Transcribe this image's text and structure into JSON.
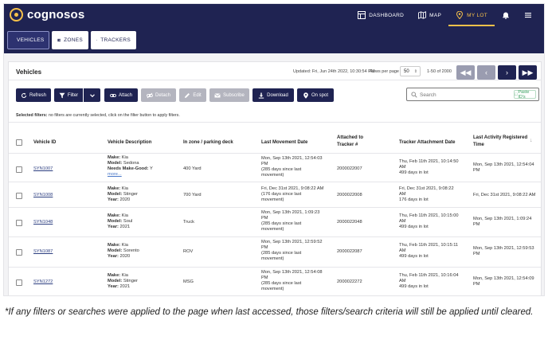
{
  "app": {
    "brand": "cognosos"
  },
  "topnav": [
    {
      "label": "DASHBOARD",
      "icon": "dashboard-icon"
    },
    {
      "label": "MAP",
      "icon": "map-icon"
    },
    {
      "label": "MY LOT",
      "icon": "location-pin-icon"
    }
  ],
  "topnav_icons": [
    "bell-icon",
    "hamburger-menu-icon"
  ],
  "subtabs": [
    {
      "label": "VEHICLES",
      "icon": "car-icon"
    },
    {
      "label": "ZONES",
      "icon": "grid-icon"
    },
    {
      "label": "TRACKERS",
      "icon": "target-icon"
    }
  ],
  "panel": {
    "title": "Vehicles",
    "updated": "Updated: Fri, Jun 24th 2022, 10:30:54 PM",
    "rows_per_page_label": "Rows per page",
    "rows_per_page_value": "50",
    "range": "1-50 of 2000"
  },
  "pager": {
    "first": "first-page-icon",
    "prev": "previous-page-icon",
    "next": "next-page-icon",
    "last": "last-page-icon"
  },
  "toolbar": {
    "refresh": "Refresh",
    "filter": "Filter",
    "attach": "Attach",
    "detach": "Detach",
    "edit": "Edit",
    "subscribe": "Subscribe",
    "download": "Download",
    "on_spot": "On spot"
  },
  "search": {
    "placeholder": "Search",
    "paste": "Paste ID's"
  },
  "selected_filters": {
    "label": "Selected filters:",
    "text": "no filters are currently selected, click on the filter button to apply filters."
  },
  "columns": {
    "vehicle_id": "Vehicle ID",
    "description": "Vehicle Description",
    "zone": "In zone / parking deck",
    "last_movement": "Last Movement Date",
    "attached_1": "Attached to",
    "attached_2": "Tracker #",
    "tracker_date": "Tracker Attachment Date",
    "last_activity_1": "Last Activity Registered",
    "last_activity_2": "Time"
  },
  "desc_labels": {
    "make": "Make:",
    "model": "Model:",
    "year": "Year:",
    "needs": "Needs Make-Good:"
  },
  "rows": [
    {
      "id": "SYN1007",
      "make": "Kia",
      "model": "Sedona",
      "extra_label": "Needs Make-Good:",
      "extra_value": "Y",
      "more": "more...",
      "zone": "400 Yard",
      "mv1": "Mon, Sep 13th 2021, 12:54:03",
      "mv2": "PM",
      "mv3": "(285 days since last",
      "mv4": "movement)",
      "tracker": "2000022007",
      "ta1": "Thu, Feb 11th 2021, 10:14:50",
      "ta2": "AM",
      "ta3": "499 days in lot",
      "la1": "Mon, Sep 13th 2021, 12:54:04",
      "la2": "PM"
    },
    {
      "id": "SYN1008",
      "make": "Kia",
      "model": "Stinger",
      "extra_label": "Year:",
      "extra_value": "2020",
      "more": "",
      "zone": "700 Yard",
      "mv1": "Fri, Dec 31st 2021, 9:08:22 AM",
      "mv2": "(176 days since last",
      "mv3": "movement)",
      "mv4": "",
      "tracker": "2000022008",
      "ta1": "Fri, Dec 31st 2021, 9:08:22",
      "ta2": "AM",
      "ta3": "176 days in lot",
      "la1": "Fri, Dec 31st 2021, 9:08:22 AM",
      "la2": ""
    },
    {
      "id": "SYN1048",
      "make": "Kia",
      "model": "Soul",
      "extra_label": "Year:",
      "extra_value": "2021",
      "more": "",
      "zone": "Truck",
      "mv1": "Mon, Sep 13th 2021, 1:09:23",
      "mv2": "PM",
      "mv3": "(285 days since last",
      "mv4": "movement)",
      "tracker": "2000022048",
      "ta1": "Thu, Feb 11th 2021, 10:15:00",
      "ta2": "AM",
      "ta3": "499 days in lot",
      "la1": "Mon, Sep 13th 2021, 1:09:24",
      "la2": "PM"
    },
    {
      "id": "SYN1087",
      "make": "Kia",
      "model": "Sorento",
      "extra_label": "Year:",
      "extra_value": "2020",
      "more": "",
      "zone": "ROV",
      "mv1": "Mon, Sep 13th 2021, 12:59:52",
      "mv2": "PM",
      "mv3": "(285 days since last",
      "mv4": "movement)",
      "tracker": "2000022087",
      "ta1": "Thu, Feb 11th 2021, 10:15:11",
      "ta2": "AM",
      "ta3": "499 days in lot",
      "la1": "Mon, Sep 13th 2021, 12:59:53",
      "la2": "PM"
    },
    {
      "id": "SYN1272",
      "make": "Kia",
      "model": "Stinger",
      "extra_label": "Year:",
      "extra_value": "2021",
      "more": "",
      "zone": "MSG",
      "mv1": "Mon, Sep 13th 2021, 12:54:08",
      "mv2": "PM",
      "mv3": "(285 days since last",
      "mv4": "movement)",
      "tracker": "2000022272",
      "ta1": "Thu, Feb 11th 2021, 10:16:04",
      "ta2": "AM",
      "ta3": "499 days in lot",
      "la1": "Mon, Sep 13th 2021, 12:54:09",
      "la2": "PM"
    }
  ],
  "caption": "*If any filters or searches were applied to the page when last accessed, those filters/search criteria will still be applied until cleared.",
  "colors": {
    "navy": "#1f2352",
    "accent": "#f5c04a",
    "disabled": "#b4b5bf"
  }
}
